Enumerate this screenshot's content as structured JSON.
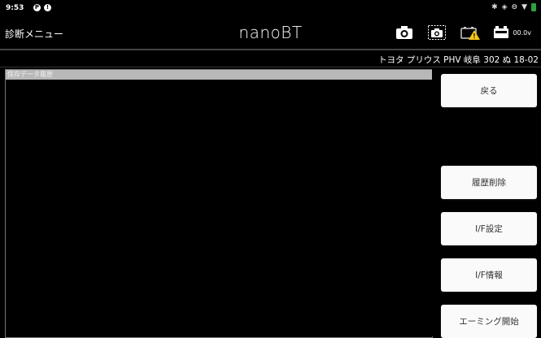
{
  "status_bar": {
    "time": "9:53",
    "right_icons": [
      "bluetooth-icon",
      "sync-icon",
      "dnd-icon",
      "wifi-icon",
      "battery-icon"
    ]
  },
  "app_bar": {
    "menu_title": "診断メニュー",
    "brand": "nanoBT",
    "voltage": "00.0v",
    "icons": [
      "camera-icon",
      "screenshot-camera-icon",
      "warning-battery-icon",
      "battery-voltage-icon"
    ]
  },
  "vehicle": {
    "label": "トヨタ プリウス PHV 岐阜 302 ぬ 18-02"
  },
  "history_panel": {
    "header": "保存データ履歴"
  },
  "sidebar": {
    "back_label": "戻る",
    "delete_history_label": "履歴削除",
    "if_settings_label": "I/F設定",
    "if_info_label": "I/F情報",
    "aiming_start_label": "エーミング開始"
  },
  "colors": {
    "background": "#000000",
    "button_bg": "#fafafa",
    "panel_header_bg": "#b8b8b8",
    "warning": "#f5c518",
    "battery_green": "#2ea043"
  }
}
